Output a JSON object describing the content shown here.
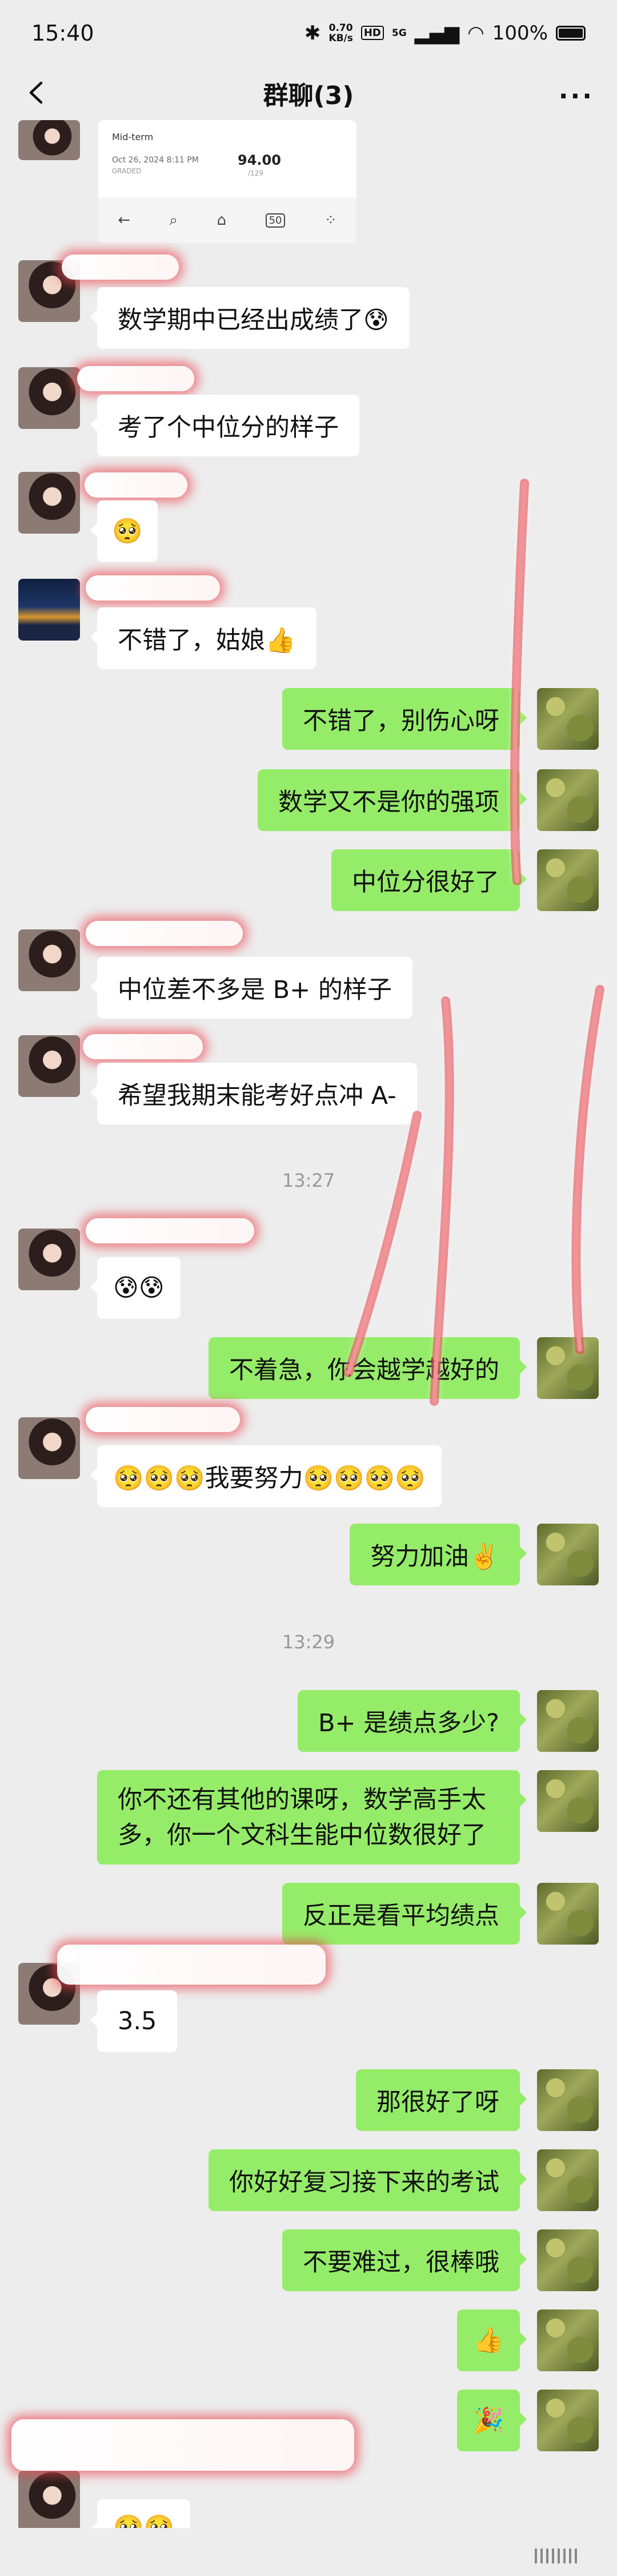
{
  "status_bar": {
    "time": "15:40",
    "speed_value": "0.70",
    "speed_unit": "KB/s",
    "hd": "HD",
    "network": "5G",
    "battery": "100%"
  },
  "header": {
    "title": "群聊(3)"
  },
  "card": {
    "title": "Mid-term",
    "date": "Oct 26, 2024 8:11 PM",
    "status": "GRADED",
    "score": "94.00",
    "total": "/129",
    "toolbar_label": "50"
  },
  "timestamps": [
    "13:27",
    "13:29"
  ],
  "messages": [
    {
      "side": "left",
      "text": "数学期中已经出成绩了😰"
    },
    {
      "side": "left",
      "text": "考了个中位分的样子"
    },
    {
      "side": "left",
      "text": "🥺"
    },
    {
      "side": "left",
      "text": "不错了，姑娘👍"
    },
    {
      "side": "right",
      "text": "不错了，别伤心呀"
    },
    {
      "side": "right",
      "text": "数学又不是你的强项"
    },
    {
      "side": "right",
      "text": "中位分很好了"
    },
    {
      "side": "left",
      "text": "中位差不多是 B+ 的样子"
    },
    {
      "side": "left",
      "text": "希望我期末能考好点冲 A-"
    },
    {
      "side": "left",
      "text": "😰😰"
    },
    {
      "side": "right",
      "text": "不着急，你会越学越好的"
    },
    {
      "side": "left",
      "text": "🥺🥺🥺我要努力🥺🥺🥺🥺"
    },
    {
      "side": "right",
      "text": "努力加油✌️"
    },
    {
      "side": "right",
      "text": "B+ 是绩点多少?"
    },
    {
      "side": "right",
      "text": "你不还有其他的课呀，数学高手太多，你一个文科生能中位数很好了"
    },
    {
      "side": "right",
      "text": "反正是看平均绩点"
    },
    {
      "side": "left",
      "text": "3.5"
    },
    {
      "side": "right",
      "text": "那很好了呀"
    },
    {
      "side": "right",
      "text": "你好好复习接下来的考试"
    },
    {
      "side": "right",
      "text": "不要难过，很棒哦"
    },
    {
      "side": "right",
      "text": "👍"
    },
    {
      "side": "right",
      "text": "🎉"
    },
    {
      "side": "left",
      "text": "🥺🥺"
    }
  ]
}
